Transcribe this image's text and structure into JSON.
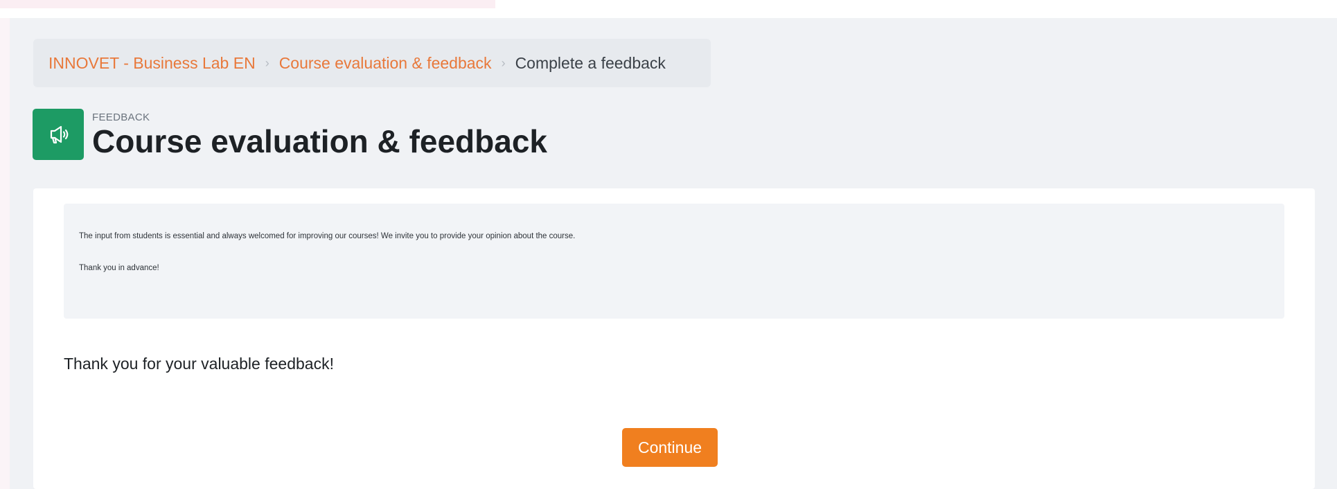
{
  "breadcrumb": {
    "items": [
      {
        "label": "INNOVET - Business Lab EN"
      },
      {
        "label": "Course evaluation & feedback"
      }
    ],
    "current": "Complete a feedback",
    "separator": "›"
  },
  "header": {
    "kicker": "FEEDBACK",
    "title": "Course evaluation & feedback",
    "icon": "megaphone-icon",
    "icon_bg_color": "#1d9b64"
  },
  "intro": {
    "line1": "The input from students is essential and always welcomed for improving our courses! We invite you to provide your opinion about the course.",
    "line2": "Thank you in advance!"
  },
  "main": {
    "thanks_message": "Thank you for your valuable feedback!",
    "continue_label": "Continue"
  },
  "colors": {
    "accent": "#f07f1f",
    "link": "#e8783a"
  }
}
